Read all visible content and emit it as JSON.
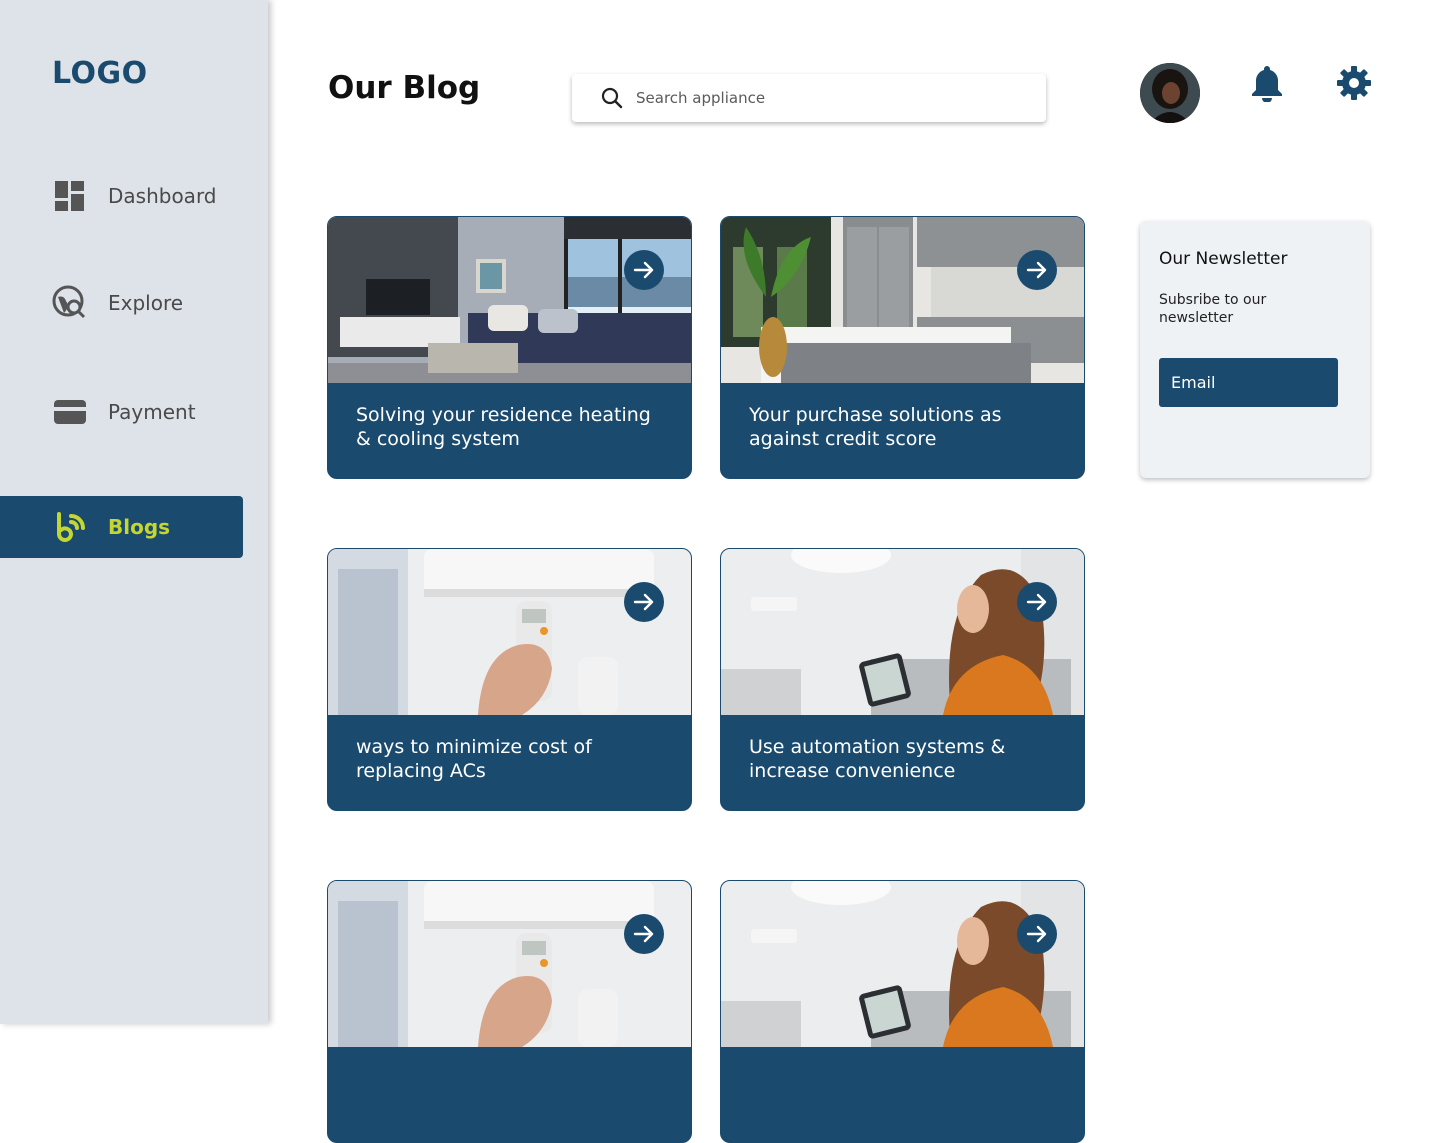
{
  "sidebar": {
    "logo": "LOGO",
    "items": [
      {
        "label": "Dashboard",
        "icon": "dashboard-icon",
        "active": false
      },
      {
        "label": "Explore",
        "icon": "explore-icon",
        "active": false
      },
      {
        "label": "Payment",
        "icon": "payment-card-icon",
        "active": false
      },
      {
        "label": "Blogs",
        "icon": "blog-feed-icon",
        "active": true
      }
    ]
  },
  "header": {
    "title": "Our Blog",
    "search_placeholder": "Search appliance",
    "avatar_icon": "user-avatar",
    "notification_icon": "bell-icon",
    "settings_icon": "gear-icon"
  },
  "posts": [
    {
      "title": "Solving your residence heating & cooling system",
      "image": "living-room-photo"
    },
    {
      "title": "Your purchase solutions as against credit score",
      "image": "kitchen-photo"
    },
    {
      "title": "ways to minimize cost of replacing ACs",
      "image": "ac-remote-photo"
    },
    {
      "title": "Use automation systems & increase convenience",
      "image": "woman-tablet-photo"
    },
    {
      "title": "",
      "image": "ac-remote-photo"
    },
    {
      "title": "",
      "image": "woman-tablet-photo"
    }
  ],
  "newsletter": {
    "title": "Our Newsletter",
    "subtitle": "Subsribe to our newsletter",
    "email_label": "Email"
  },
  "colors": {
    "primary": "#1a4a6e",
    "accent": "#c5d62f",
    "sidebar_bg": "#dde3e9"
  }
}
